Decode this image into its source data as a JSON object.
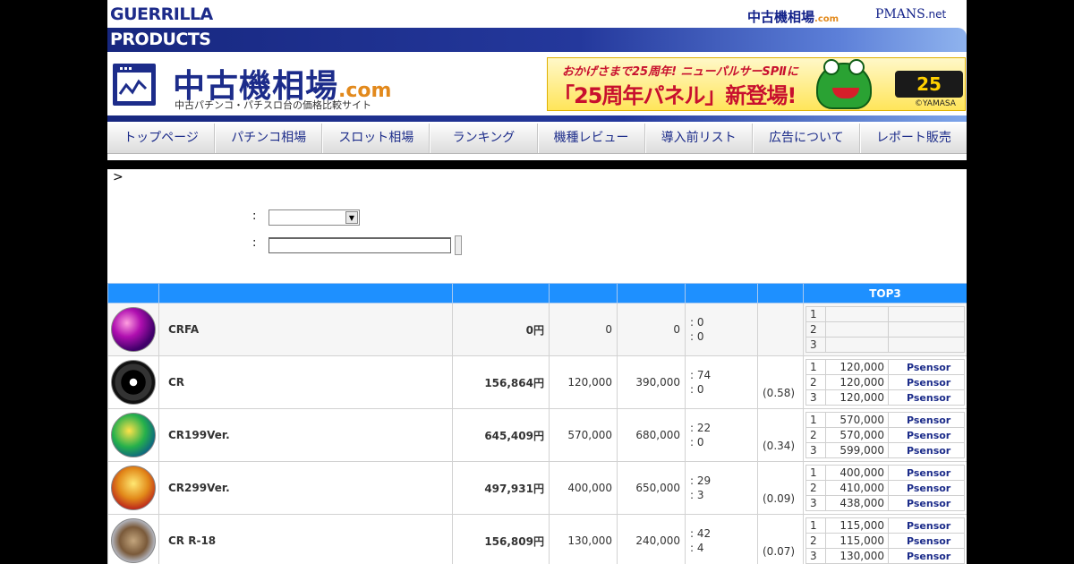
{
  "header": {
    "gp_line1": "GUERRILLA",
    "gp_line2": "PRODUCTS",
    "toplink_site": "中古機相場",
    "toplink_site_domain": ".com",
    "toplink_pmans": "PMANS",
    "toplink_pmans_suffix": ".net",
    "logo_title": "中古機相場",
    "logo_domain": ".com",
    "logo_subtitle": "中古パチンコ・パチスロ台の価格比較サイト"
  },
  "banner": {
    "line1": "おかげさまで25周年! ニューパルサーSPⅡに",
    "line2": "「25周年パネル」新登場!",
    "badge": "25",
    "copyright": "©YAMASA"
  },
  "nav": {
    "items": [
      "トップページ",
      "パチンコ相場",
      "スロット相場",
      "ランキング",
      "機種レビュー",
      "導入前リスト",
      "広告について",
      "レポート販売"
    ]
  },
  "breadcrumb": ">",
  "form": {
    "colon1": ":",
    "colon2": ":",
    "select_value": "",
    "input_value": ""
  },
  "table": {
    "headers": [
      "",
      "",
      "",
      "",
      "",
      "",
      "",
      "TOP3"
    ],
    "rows": [
      {
        "name": "CRFA",
        "price": "0円",
        "v1": "0",
        "v2": "0",
        "count1": ": 0",
        "count2": ": 0",
        "ratio": "",
        "top3": [
          {
            "rank": "1",
            "price": "",
            "shop": ""
          },
          {
            "rank": "2",
            "price": "",
            "shop": ""
          },
          {
            "rank": "3",
            "price": "",
            "shop": ""
          }
        ]
      },
      {
        "name": "CR",
        "price": "156,864円",
        "v1": "120,000",
        "v2": "390,000",
        "count1": ": 74",
        "count2": ": 0",
        "ratio": "(0.58)",
        "top3": [
          {
            "rank": "1",
            "price": "120,000",
            "shop": "Psensor"
          },
          {
            "rank": "2",
            "price": "120,000",
            "shop": "Psensor"
          },
          {
            "rank": "3",
            "price": "120,000",
            "shop": "Psensor"
          }
        ]
      },
      {
        "name": "CR199Ver.",
        "price": "645,409円",
        "v1": "570,000",
        "v2": "680,000",
        "count1": ": 22",
        "count2": ": 0",
        "ratio": "(0.34)",
        "top3": [
          {
            "rank": "1",
            "price": "570,000",
            "shop": "Psensor"
          },
          {
            "rank": "2",
            "price": "570,000",
            "shop": "Psensor"
          },
          {
            "rank": "3",
            "price": "599,000",
            "shop": "Psensor"
          }
        ]
      },
      {
        "name": "CR299Ver.",
        "price": "497,931円",
        "v1": "400,000",
        "v2": "650,000",
        "count1": ": 29",
        "count2": ": 3",
        "ratio": "(0.09)",
        "top3": [
          {
            "rank": "1",
            "price": "400,000",
            "shop": "Psensor"
          },
          {
            "rank": "2",
            "price": "410,000",
            "shop": "Psensor"
          },
          {
            "rank": "3",
            "price": "438,000",
            "shop": "Psensor"
          }
        ]
      },
      {
        "name": "CR R-18",
        "price": "156,809円",
        "v1": "130,000",
        "v2": "240,000",
        "count1": ": 42",
        "count2": ": 4",
        "ratio": "(0.07)",
        "top3": [
          {
            "rank": "1",
            "price": "115,000",
            "shop": "Psensor"
          },
          {
            "rank": "2",
            "price": "115,000",
            "shop": "Psensor"
          },
          {
            "rank": "3",
            "price": "130,000",
            "shop": "Psensor"
          }
        ]
      }
    ]
  }
}
